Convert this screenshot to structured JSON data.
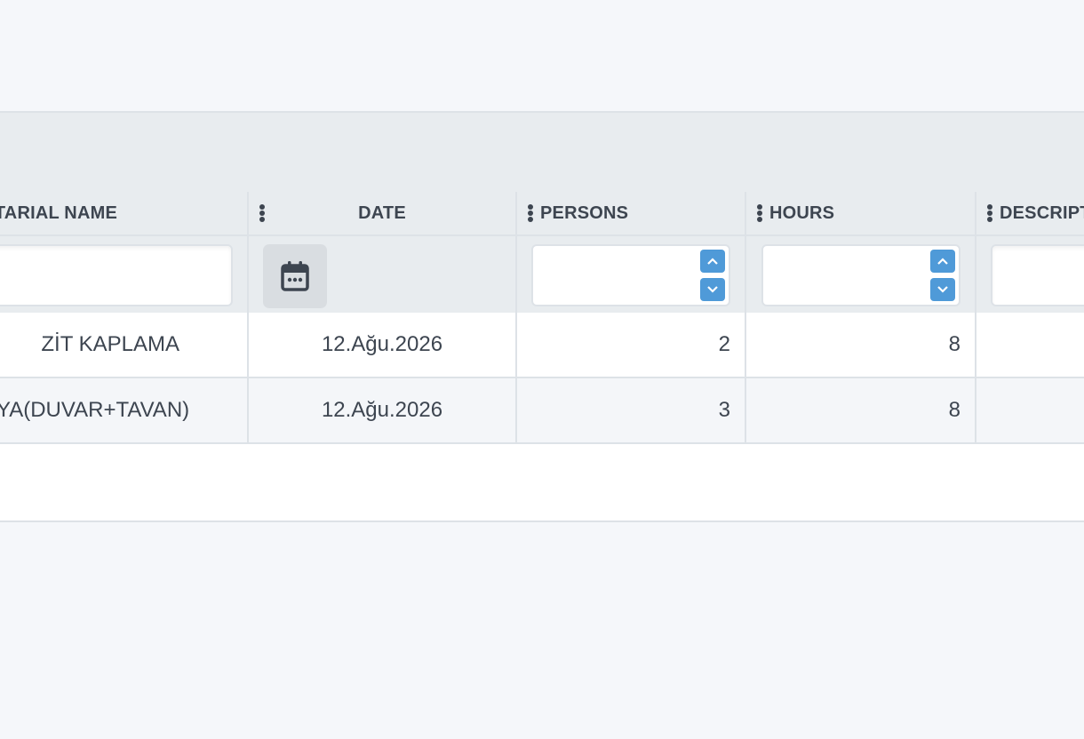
{
  "columns": {
    "material_name": "TARIAL NAME",
    "date": "DATE",
    "persons": "PERSONS",
    "hours": "HOURS",
    "description": "DESCRIPT"
  },
  "icons": {
    "column_menu": "kebab-vertical-icon",
    "calendar": "calendar-icon",
    "spin_up": "chevron-up-icon",
    "spin_down": "chevron-down-icon"
  },
  "colors": {
    "spin_button": "#4f9ad8",
    "header_bg": "#e8ecef",
    "page_bg": "#f5f7fa"
  },
  "rows": [
    {
      "material_name": "ZİT KAPLAMA",
      "date": "12.Ağu.2026",
      "persons": "2",
      "hours": "8",
      "description": ""
    },
    {
      "material_name": "YA(DUVAR+TAVAN)",
      "date": "12.Ağu.2026",
      "persons": "3",
      "hours": "8",
      "description": ""
    }
  ]
}
